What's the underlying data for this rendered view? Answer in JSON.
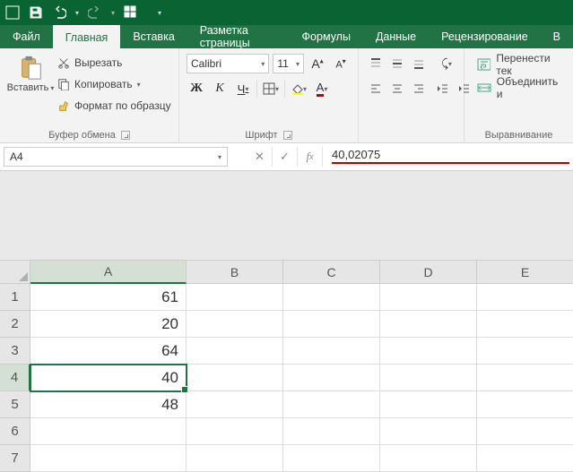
{
  "qat": {
    "save": "save",
    "undo": "undo",
    "redo": "redo",
    "touch": "touch"
  },
  "tabs": {
    "file": "Файл",
    "items": [
      "Главная",
      "Вставка",
      "Разметка страницы",
      "Формулы",
      "Данные",
      "Рецензирование",
      "В"
    ],
    "active": 0
  },
  "clipboard": {
    "paste": "Вставить",
    "cut": "Вырезать",
    "copy": "Копировать",
    "format_painter": "Формат по образцу",
    "label": "Буфер обмена"
  },
  "font": {
    "name": "Calibri",
    "size": "11",
    "grow": "A",
    "shrink": "A",
    "bold": "Ж",
    "italic": "К",
    "underline": "Ч",
    "label": "Шрифт"
  },
  "align": {
    "wrap": "Перенести тек",
    "merge": "Объединить и",
    "label": "Выравнивание"
  },
  "namebox": "A4",
  "formula": "40,02075",
  "columns": [
    "A",
    "B",
    "C",
    "D",
    "E"
  ],
  "rows": [
    "1",
    "2",
    "3",
    "4",
    "5",
    "6",
    "7"
  ],
  "active": {
    "row": 3,
    "col": 0
  },
  "data": {
    "A1": "61",
    "A2": "20",
    "A3": "64",
    "A4": "40",
    "A5": "48"
  },
  "chart_data": {
    "type": "table",
    "columns": [
      "A"
    ],
    "rows": [
      61,
      20,
      64,
      40,
      48
    ],
    "note": "Cell A4 displays 40; formula bar shows underlying value 40,02075"
  }
}
